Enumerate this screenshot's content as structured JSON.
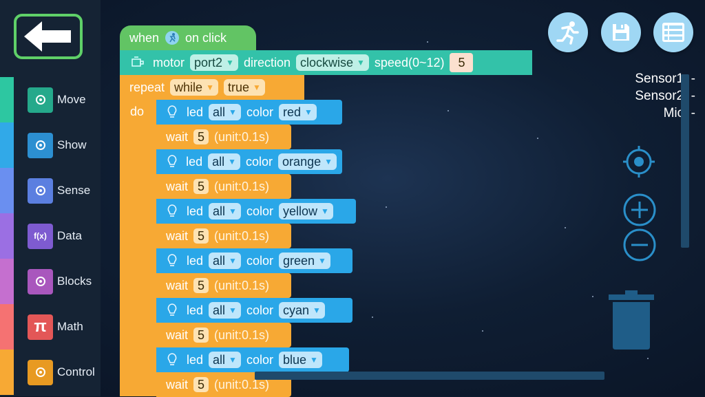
{
  "sidebar": {
    "categories": [
      {
        "label": "Move",
        "icon": "bicycle-icon",
        "color": "#2dc7a1",
        "icon_bg": "#25a98b"
      },
      {
        "label": "Show",
        "icon": "led-light-icon",
        "color": "#31a9e8",
        "icon_bg": "#2c8fd1"
      },
      {
        "label": "Sense",
        "icon": "sensor-icon",
        "color": "#6a8ff0",
        "icon_bg": "#5b7fe0"
      },
      {
        "label": "Data",
        "icon": "function-icon",
        "color": "#9b6fe3",
        "icon_bg": "#7e5bd0",
        "glyph": "f(x)"
      },
      {
        "label": "Blocks",
        "icon": "hand-pointer-icon",
        "color": "#c56fcf",
        "icon_bg": "#a957bd"
      },
      {
        "label": "Math",
        "icon": "pi-icon",
        "color": "#f57272",
        "icon_bg": "#e35757",
        "glyph": "π"
      },
      {
        "label": "Control",
        "icon": "list-icon",
        "color": "#f7a934",
        "icon_bg": "#e89a22"
      }
    ]
  },
  "event_block": {
    "when": "when",
    "on_click": "on click"
  },
  "motor_block": {
    "motor": "motor",
    "port": "port2",
    "direction": "direction",
    "direction_value": "clockwise",
    "speed_label": "speed(0~12)",
    "speed_value": "5"
  },
  "repeat_block": {
    "repeat": "repeat",
    "mode": "while",
    "condition": "true",
    "do": "do"
  },
  "led_blocks": [
    {
      "led": "led",
      "target": "all",
      "color_label": "color",
      "color": "red"
    },
    {
      "led": "led",
      "target": "all",
      "color_label": "color",
      "color": "orange"
    },
    {
      "led": "led",
      "target": "all",
      "color_label": "color",
      "color": "yellow"
    },
    {
      "led": "led",
      "target": "all",
      "color_label": "color",
      "color": "green"
    },
    {
      "led": "led",
      "target": "all",
      "color_label": "color",
      "color": "cyan"
    },
    {
      "led": "led",
      "target": "all",
      "color_label": "color",
      "color": "blue"
    }
  ],
  "wait_blocks": [
    {
      "wait": "wait",
      "value": "5",
      "unit": "(unit:0.1s)"
    },
    {
      "wait": "wait",
      "value": "5",
      "unit": "(unit:0.1s)"
    },
    {
      "wait": "wait",
      "value": "5",
      "unit": "(unit:0.1s)"
    },
    {
      "wait": "wait",
      "value": "5",
      "unit": "(unit:0.1s)"
    },
    {
      "wait": "wait",
      "value": "5",
      "unit": "(unit:0.1s)"
    },
    {
      "wait": "wait",
      "value": "5",
      "unit": "(unit:0.1s)"
    }
  ],
  "sensors": [
    {
      "label": "Sensor1:",
      "value": "-"
    },
    {
      "label": "Sensor2:",
      "value": "-"
    },
    {
      "label": "Mic:",
      "value": "-"
    }
  ],
  "colors": {
    "event": "#62c464",
    "motor": "#33c2a9",
    "control": "#f7a934",
    "led": "#2aa7e8",
    "back_border": "#5fd068"
  }
}
